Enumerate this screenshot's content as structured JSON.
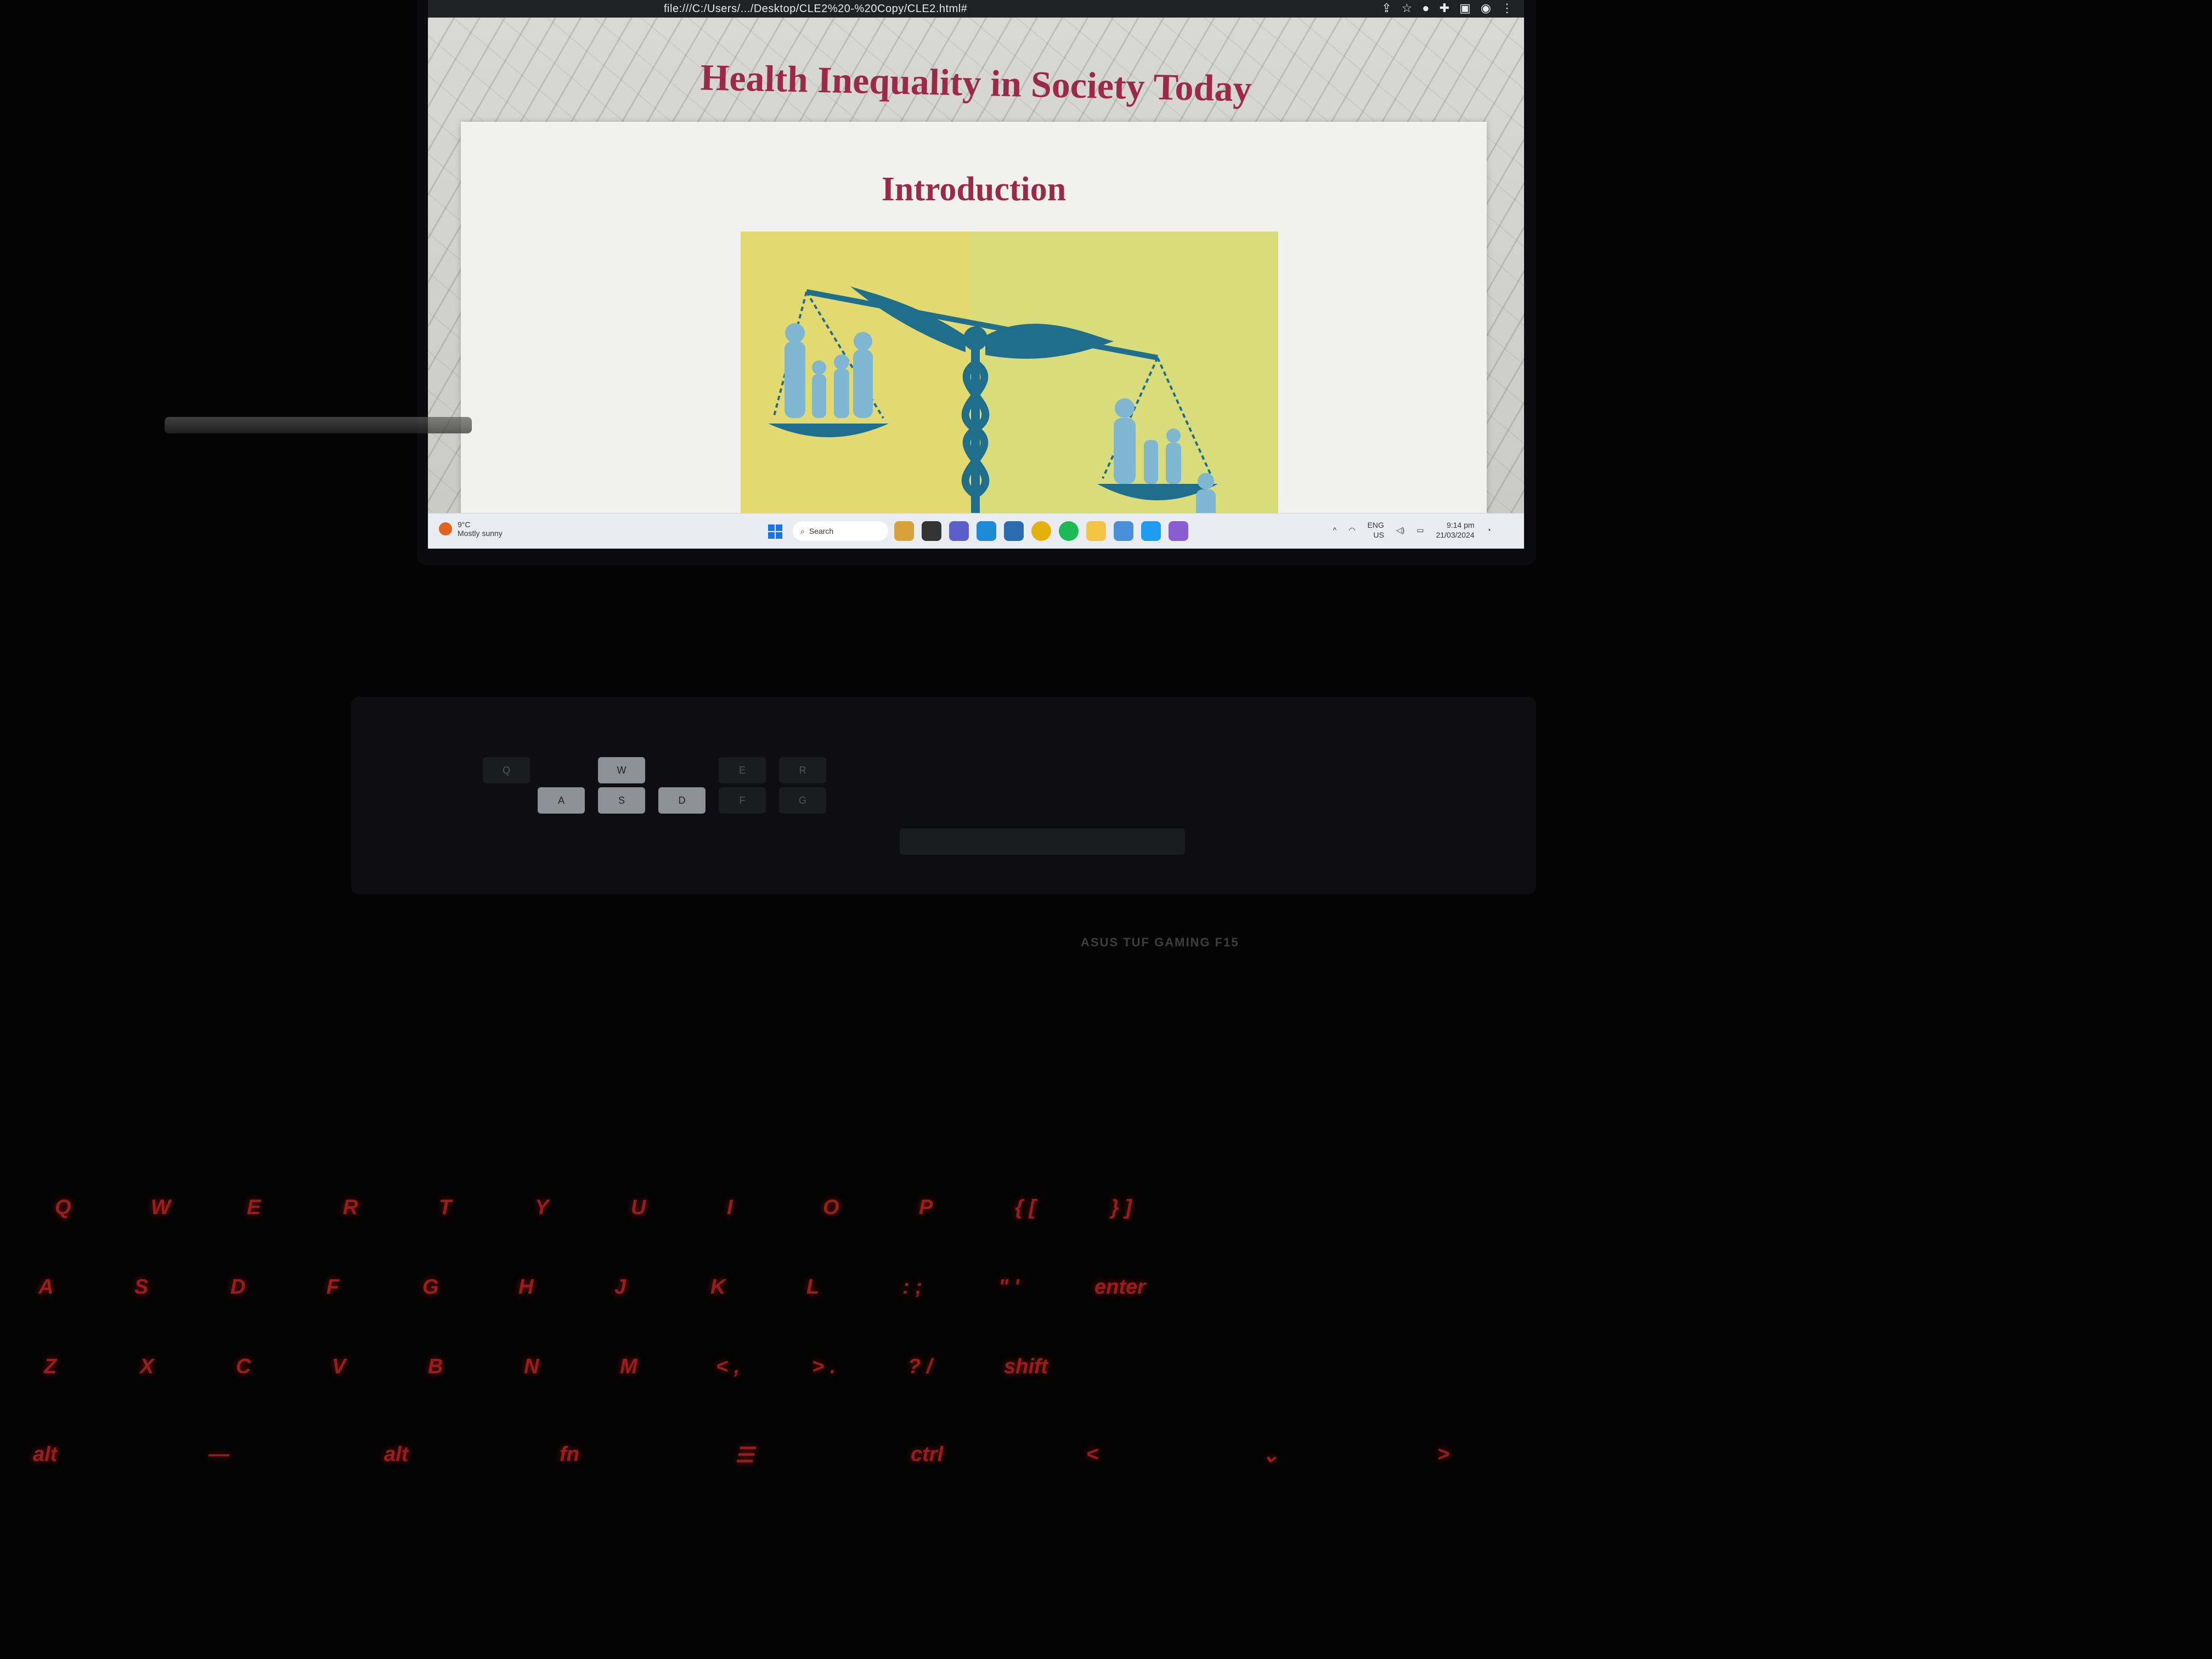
{
  "browser": {
    "url": "file:///C:/Users/.../Desktop/CLE2%20-%20Copy/CLE2.html#"
  },
  "page": {
    "title": "Health Inequality in Society Today",
    "section_title": "Introduction"
  },
  "taskbar": {
    "weather_temp": "9°C",
    "weather_desc": "Mostly sunny",
    "search_label": "Search",
    "language": "ENG",
    "region": "US",
    "time": "9:14 pm",
    "date": "21/03/2024"
  },
  "laptop": {
    "brand": "ASUS TUF GAMING F15"
  },
  "external_keyboard": {
    "rows": [
      [
        "Q",
        "W",
        "E",
        "R",
        "T",
        "Y",
        "U",
        "I",
        "O",
        "P",
        "{ [",
        "} ]"
      ],
      [
        "A",
        "S",
        "D",
        "F",
        "G",
        "H",
        "J",
        "K",
        "L",
        ": ;",
        "\" '",
        "enter"
      ],
      [
        "Z",
        "X",
        "C",
        "V",
        "B",
        "N",
        "M",
        "< ,",
        "> .",
        "? /",
        "shift"
      ],
      [
        "alt",
        "—",
        "alt",
        "fn",
        "☰",
        "ctrl",
        "<",
        "⌄",
        ">"
      ]
    ]
  },
  "colors": {
    "title": "#9b2a48",
    "illustration_bg": "#d9dc7a",
    "illustration_figure": "#1f6e8c",
    "key_glow": "#c4241f"
  }
}
